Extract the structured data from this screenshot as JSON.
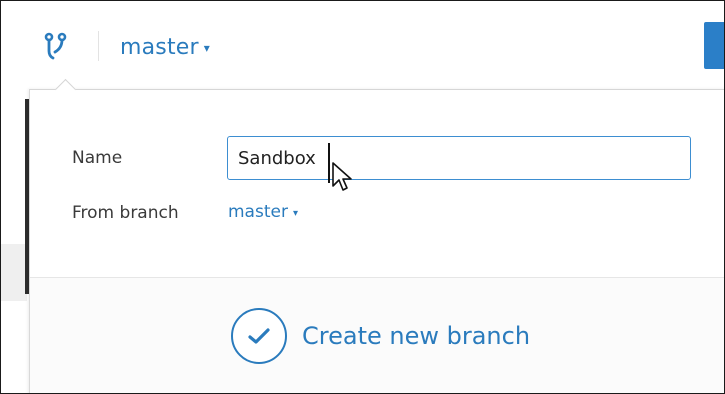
{
  "header": {
    "icon": "git-branch-icon",
    "branch": "master",
    "caret": "▾"
  },
  "form": {
    "name_label": "Name",
    "name_value": "Sandbox",
    "from_label": "From branch",
    "from_value": "master",
    "from_caret": "▾"
  },
  "action": {
    "icon": "checkmark-circle-icon",
    "label": "Create new branch"
  },
  "colors": {
    "accent": "#2a7bbd",
    "primary_button": "#2b7fc8",
    "input_focus_border": "#3d8ed1"
  }
}
